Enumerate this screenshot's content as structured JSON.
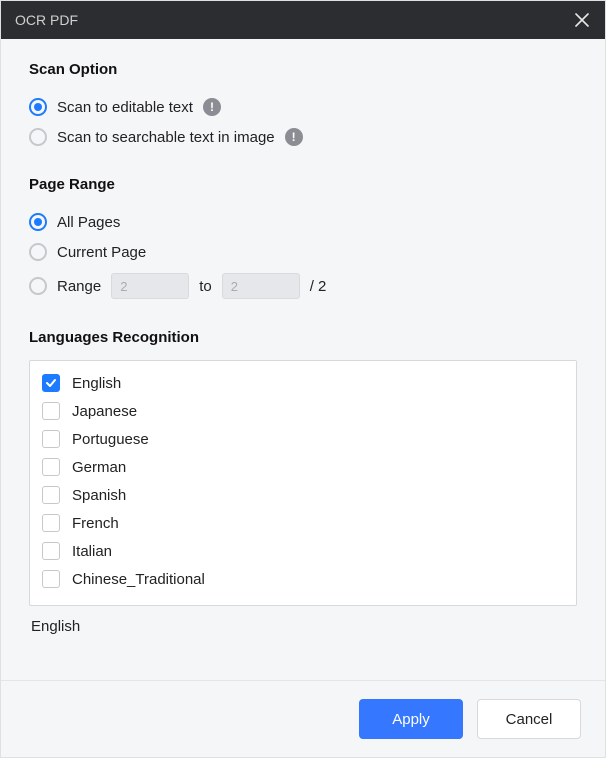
{
  "title": "OCR PDF",
  "sections": {
    "scan_option": {
      "heading": "Scan Option",
      "options": [
        {
          "label": "Scan to editable text",
          "selected": true,
          "info": true
        },
        {
          "label": "Scan to searchable text in image",
          "selected": false,
          "info": true
        }
      ]
    },
    "page_range": {
      "heading": "Page Range",
      "options": {
        "all": {
          "label": "All Pages",
          "selected": true
        },
        "current": {
          "label": "Current Page",
          "selected": false
        },
        "range": {
          "label": "Range",
          "selected": false,
          "from": "2",
          "to_label": "to",
          "to": "2",
          "total_label": "/ 2"
        }
      }
    },
    "languages": {
      "heading": "Languages Recognition",
      "items": [
        {
          "label": "English",
          "checked": true
        },
        {
          "label": "Japanese",
          "checked": false
        },
        {
          "label": "Portuguese",
          "checked": false
        },
        {
          "label": "German",
          "checked": false
        },
        {
          "label": "Spanish",
          "checked": false
        },
        {
          "label": "French",
          "checked": false
        },
        {
          "label": "Italian",
          "checked": false
        },
        {
          "label": "Chinese_Traditional",
          "checked": false
        }
      ],
      "selected_summary": "English"
    }
  },
  "footer": {
    "apply": "Apply",
    "cancel": "Cancel"
  },
  "colors": {
    "accent": "#3577ff"
  }
}
